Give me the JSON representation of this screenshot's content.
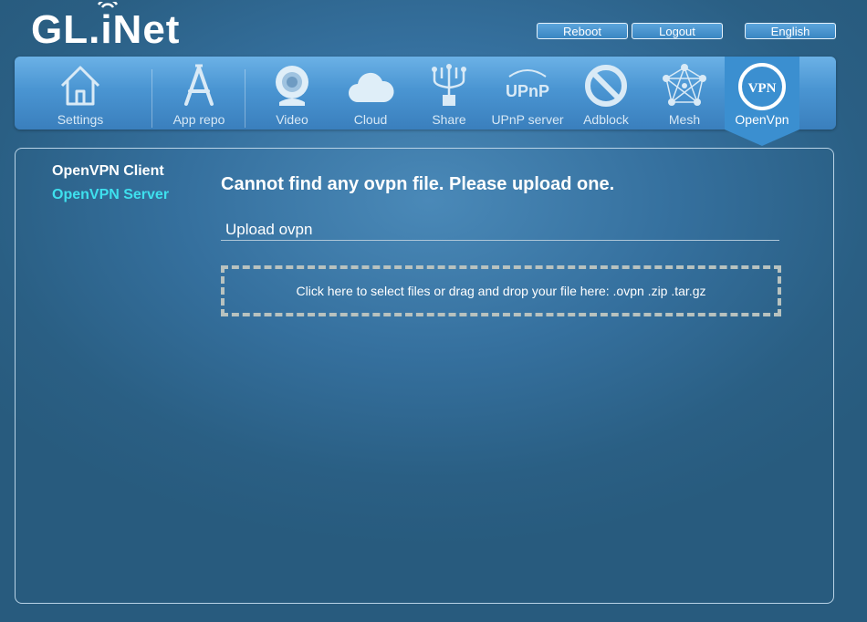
{
  "brand": {
    "logo_text": "GL.iNet"
  },
  "header": {
    "reboot_label": "Reboot",
    "logout_label": "Logout",
    "language_label": "English"
  },
  "nav": {
    "items": [
      {
        "label": "Settings",
        "icon": "home-icon"
      },
      {
        "label": "App repo",
        "icon": "app-repo-icon"
      },
      {
        "label": "Video",
        "icon": "webcam-icon"
      },
      {
        "label": "Cloud",
        "icon": "cloud-icon"
      },
      {
        "label": "Share",
        "icon": "usb-share-icon"
      },
      {
        "label": "UPnP server",
        "icon": "upnp-icon",
        "icon_text": "UPnP"
      },
      {
        "label": "Adblock",
        "icon": "adblock-icon"
      },
      {
        "label": "Mesh",
        "icon": "mesh-icon"
      },
      {
        "label": "OpenVpn",
        "icon": "vpn-icon",
        "icon_text": "VPN",
        "active": true
      }
    ]
  },
  "sidebar": {
    "items": [
      {
        "label": "OpenVPN Client"
      },
      {
        "label": "OpenVPN Server"
      }
    ]
  },
  "main": {
    "message": "Cannot find any ovpn file. Please upload one.",
    "upload_title": "Upload ovpn",
    "dropzone_text": "Click here to select files or drag and drop your file here: .ovpn .zip .tar.gz"
  },
  "colors": {
    "accent": "#3ee0ee",
    "navbar": "#4a95d2",
    "background": "#2a5f84"
  }
}
